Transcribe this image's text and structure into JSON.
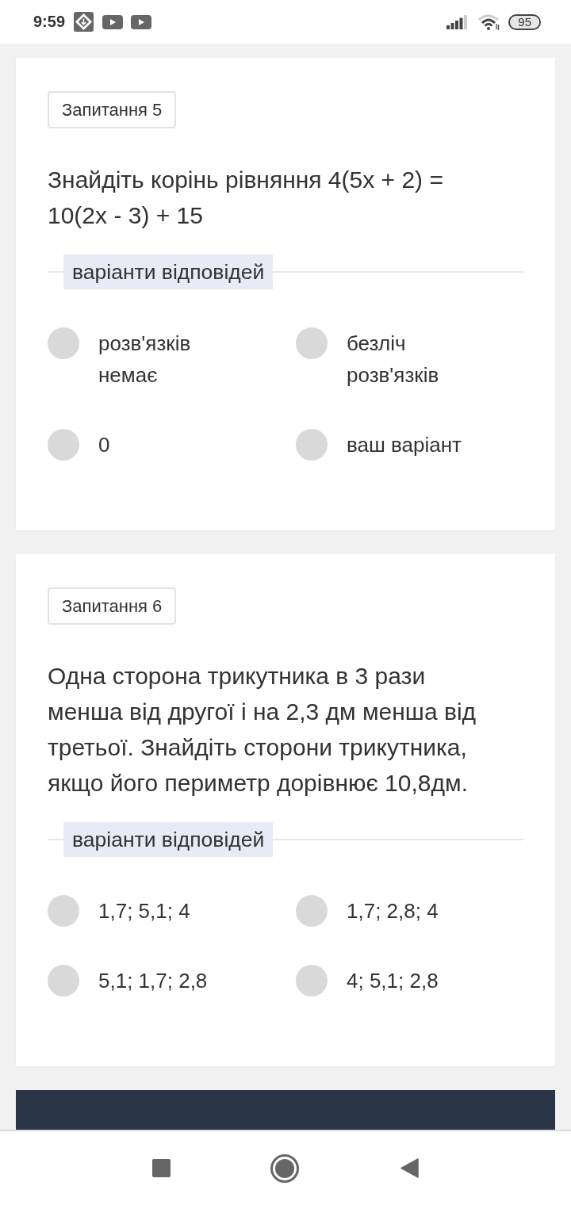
{
  "status_bar": {
    "time": "9:59",
    "battery": "95"
  },
  "questions": [
    {
      "number": "Запитання 5",
      "text": "Знайдіть корінь рівняння 4(5x + 2) = 10(2x - 3) + 15",
      "options_label": "варіанти відповідей",
      "options": [
        {
          "label": "розв'язків немає",
          "selected": false
        },
        {
          "label": "безліч розв'язків",
          "selected": false
        },
        {
          "label": "0",
          "selected": false
        },
        {
          "label": "ваш варіант",
          "selected": false
        }
      ]
    },
    {
      "number": "Запитання 6",
      "text": "Одна сторона трикутника в 3 рази менша від другої і на 2,3 дм менша від третьої. Знайдіть сторони трикутника, якщо його периметр дорівнює 10,8дм.",
      "options_label": "варіанти відповідей",
      "options": [
        {
          "label": "1,7; 5,1; 4",
          "selected": false
        },
        {
          "label": "1,7; 2,8; 4",
          "selected": false
        },
        {
          "label": "5,1; 1,7; 2,8",
          "selected": false
        },
        {
          "label": "4; 5,1; 2,8",
          "selected": false
        }
      ]
    }
  ]
}
